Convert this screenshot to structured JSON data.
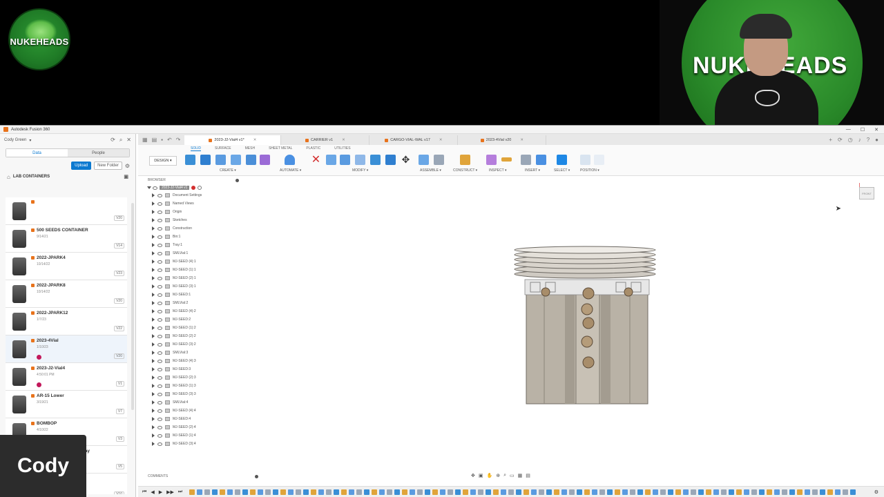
{
  "overlay": {
    "logo_text": "NUKEHEADS",
    "webcam_brand": "NUKEHEADS",
    "presenter_name": "Cody"
  },
  "window": {
    "title": "Autodesk Fusion 360",
    "controls": [
      "—",
      "☐",
      "✕"
    ]
  },
  "sidebar": {
    "user": "Cody Green",
    "data_tab": "Data",
    "people_tab": "People",
    "upload_label": "Upload",
    "new_folder_label": "New Folder",
    "breadcrumb": "LAB CONTAINERS",
    "files": [
      {
        "name": "",
        "date": "",
        "version": "V20"
      },
      {
        "name": "500 SEEDS CONTAINER",
        "date": "9/14/21",
        "version": "V14"
      },
      {
        "name": "2022-JPARK4",
        "date": "10/14/22",
        "version": "V23"
      },
      {
        "name": "2022-JPARK8",
        "date": "10/14/22",
        "version": "V20"
      },
      {
        "name": "2022-JPARK12",
        "date": "1/7/23",
        "version": "V22"
      },
      {
        "name": "2023-4Vial",
        "date": "1/10/23",
        "version": "V20",
        "badge": true,
        "selected": true
      },
      {
        "name": "2023-J2-Vial4",
        "date": "4:50:01 PM",
        "version": "V1",
        "badge": true
      },
      {
        "name": "AR-15 Lower",
        "date": "3/19/21",
        "version": "V7"
      },
      {
        "name": "BOMBOP",
        "date": "4/10/22",
        "version": "V3"
      },
      {
        "name": "ConvenientStore Display",
        "date": "",
        "version": "V5"
      },
      {
        "name": "",
        "date": "",
        "version": "V10"
      }
    ]
  },
  "tabs": [
    {
      "label": "2023-J2-Vial4 v1*",
      "active": true
    },
    {
      "label": "CARRIER v1",
      "active": false
    },
    {
      "label": "CARGO-VIAL-WAL v17",
      "active": false
    },
    {
      "label": "2023-4Vial v20",
      "active": false
    }
  ],
  "ribbon": {
    "workspace": "DESIGN ▾",
    "tabs": [
      "SOLID",
      "SURFACE",
      "MESH",
      "SHEET METAL",
      "PLASTIC",
      "UTILITIES"
    ],
    "groups": [
      "CREATE ▾",
      "AUTOMATE ▾",
      "MODIFY ▾",
      "ASSEMBLE ▾",
      "CONSTRUCT ▾",
      "INSPECT ▾",
      "INSERT ▾",
      "SELECT ▾",
      "POSITION ▾"
    ]
  },
  "browser": {
    "header": "BROWSER",
    "root": "2023-J2-Vial4 v1",
    "items": [
      "Document Settings",
      "Named Views",
      "Origin",
      "Sketches",
      "Construction",
      "Bin:1",
      "Tray:1",
      "SMLVial:1",
      "MJ-SEED (4):1",
      "MJ-SEED (1):1",
      "MJ-SEED (2):1",
      "MJ-SEED (3):1",
      "MJ-SEED:1",
      "SMLVial:2",
      "MJ-SEED (4):2",
      "MJ-SEED:2",
      "MJ-SEED (1):2",
      "MJ-SEED (2):2",
      "MJ-SEED (3):2",
      "SMLVial:3",
      "MJ-SEED (4):3",
      "MJ-SEED:3",
      "MJ-SEED (2):3",
      "MJ-SEED (1):3",
      "MJ-SEED (3):3",
      "SMLVial:4",
      "MJ-SEED (4):4",
      "MJ-SEED:4",
      "MJ-SEED (2):4",
      "MJ-SEED (1):4",
      "MJ-SEED (3):4"
    ]
  },
  "viewport": {
    "viewcube_label": "FRONT"
  },
  "comments": {
    "label": "COMMENTS"
  },
  "colors": {
    "accent": "#0b79d0",
    "fusion_orange": "#e8731c",
    "model_body": "#b9b2a6"
  }
}
